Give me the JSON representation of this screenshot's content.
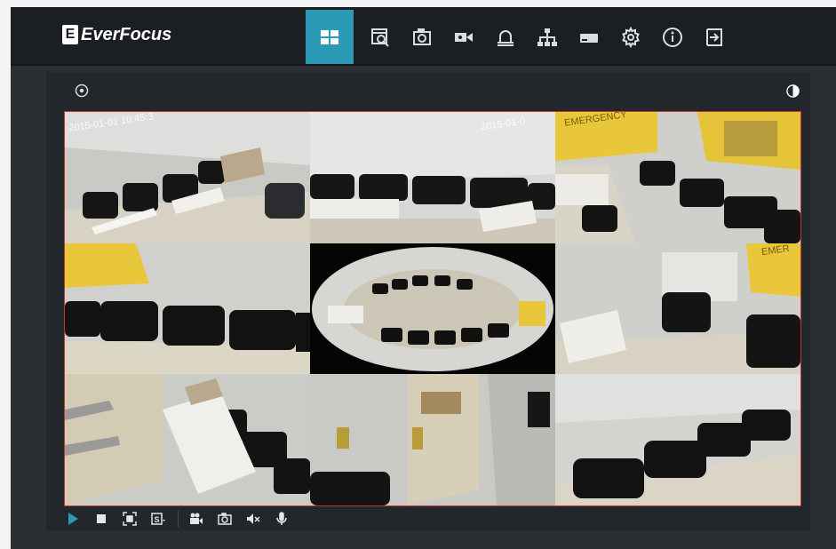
{
  "brand": {
    "logo_mark": "E",
    "name": "EverFocus"
  },
  "nav": {
    "items": [
      {
        "icon": "live-view-grid-icon",
        "active": true
      },
      {
        "icon": "playback-icon",
        "active": false
      },
      {
        "icon": "snapshot-icon",
        "active": false
      },
      {
        "icon": "record-camera-icon",
        "active": false
      },
      {
        "icon": "alarm-bell-icon",
        "active": false
      },
      {
        "icon": "network-icon",
        "active": false
      },
      {
        "icon": "storage-icon",
        "active": false
      },
      {
        "icon": "settings-gear-icon",
        "active": false
      },
      {
        "icon": "info-icon",
        "active": false
      },
      {
        "icon": "logout-icon",
        "active": false
      }
    ],
    "active_color": "#2b9ab5"
  },
  "cameras": [
    {
      "stamp": "2015-01-01 10:45:3"
    },
    {
      "stamp": "2015-01-0"
    },
    {
      "stamp": "EMERGENCY"
    },
    {
      "stamp": ""
    },
    {
      "stamp": ""
    },
    {
      "stamp": "EMER"
    },
    {
      "stamp": ""
    },
    {
      "stamp": ""
    },
    {
      "stamp": ""
    }
  ],
  "controls": [
    "play-icon",
    "stop-icon",
    "fullscreen-icon",
    "stream-select-icon",
    "record-icon",
    "snapshot-icon",
    "mute-icon",
    "microphone-icon"
  ],
  "colors": {
    "frame": "#2b2f34",
    "topbar": "#1b1e22",
    "grid_border": "#c0392b",
    "play": "#2b9ab5"
  }
}
